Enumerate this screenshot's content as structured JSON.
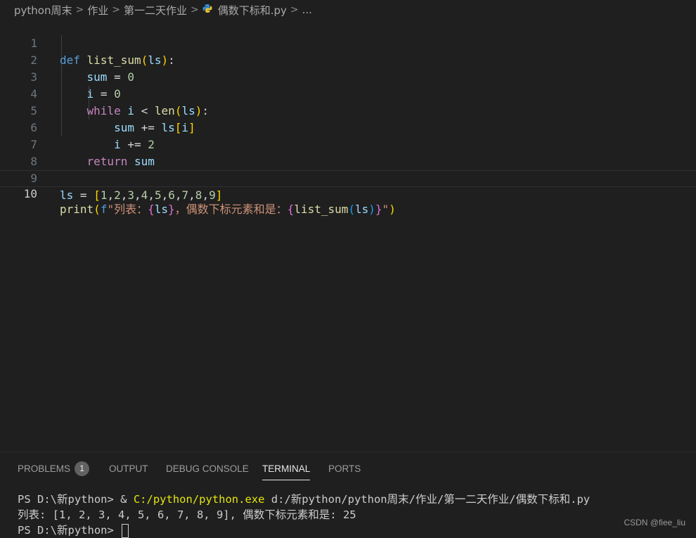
{
  "breadcrumb": {
    "items": [
      "python周末",
      "作业",
      "第一二天作业",
      "偶数下标和.py",
      "..."
    ]
  },
  "editor": {
    "line_numbers": [
      "1",
      "2",
      "3",
      "4",
      "5",
      "6",
      "7",
      "8",
      "9",
      "10"
    ],
    "tokens": {
      "def": "def",
      "list_sum": "list_sum",
      "ls": "ls",
      "sum": "sum",
      "i": "i",
      "zero": "0",
      "two": "2",
      "while": "while",
      "len": "len",
      "return": "return",
      "print": "print",
      "f_prefix": "f",
      "str_part1": "\"列表：",
      "str_part2": "，偶数下标元素和是：",
      "str_end": "\"",
      "list_values": [
        "1",
        "2",
        "3",
        "4",
        "5",
        "6",
        "7",
        "8",
        "9"
      ]
    }
  },
  "panel": {
    "tabs": [
      {
        "label": "PROBLEMS",
        "badge": "1"
      },
      {
        "label": "OUTPUT"
      },
      {
        "label": "DEBUG CONSOLE"
      },
      {
        "label": "TERMINAL"
      },
      {
        "label": "PORTS"
      }
    ],
    "active_tab": "TERMINAL",
    "terminal": {
      "prompt1": "PS D:\\新python> ",
      "amp": "& ",
      "exe": "C:/python/python.exe",
      "script_path": " d:/新python/python周末/作业/第一二天作业/偶数下标和.py",
      "output": "列表: [1, 2, 3, 4, 5, 6, 7, 8, 9], 偶数下标元素和是: 25",
      "prompt2": "PS D:\\新python> "
    }
  },
  "watermark": "CSDN @fiee_liu",
  "colors": {
    "background": "#1f1f1f",
    "keyword_blue": "#569cd6",
    "keyword_purple": "#c586c0",
    "function": "#dcdcaa",
    "variable": "#9cdcfe",
    "number": "#b5cea8",
    "string": "#ce9178"
  },
  "icons": {
    "file_icon": "python-icon",
    "separator": "chevron-right-icon"
  }
}
